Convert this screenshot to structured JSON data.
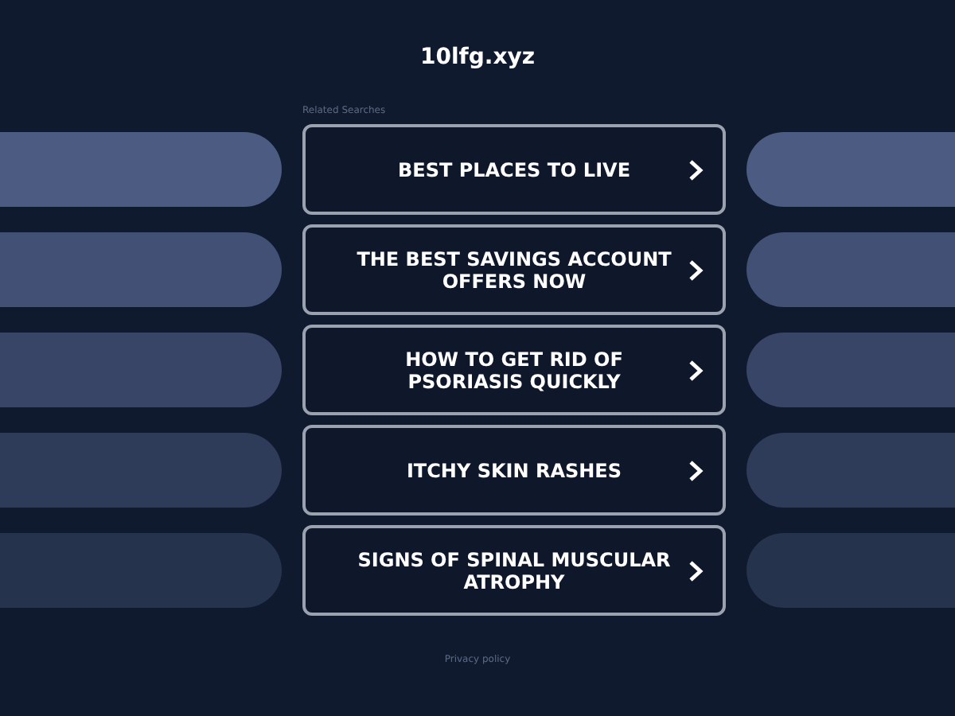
{
  "site": {
    "title": "10lfg.xyz"
  },
  "related": {
    "label": "Related Searches",
    "links": [
      {
        "text": "BEST PLACES TO LIVE"
      },
      {
        "text": "THE BEST SAVINGS ACCOUNT OFFERS NOW"
      },
      {
        "text": "HOW TO GET RID OF PSORIASIS QUICKLY"
      },
      {
        "text": "ITCHY SKIN RASHES"
      },
      {
        "text": "SIGNS OF SPINAL MUSCULAR ATROPHY"
      }
    ]
  },
  "footer": {
    "privacy": "Privacy policy"
  }
}
